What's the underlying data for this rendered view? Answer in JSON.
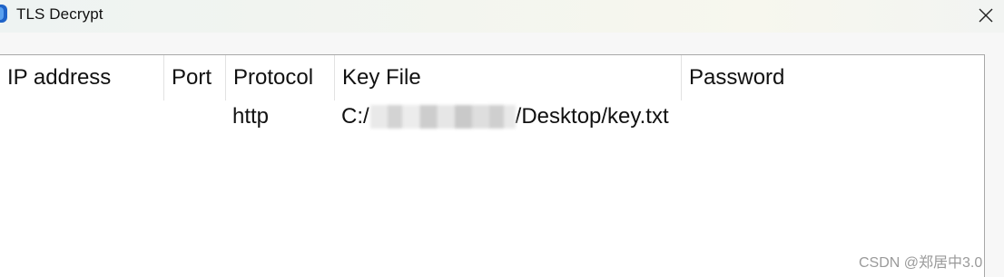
{
  "window": {
    "title": "TLS Decrypt",
    "close_icon": "close-icon"
  },
  "table": {
    "columns": [
      "IP address",
      "Port",
      "Protocol",
      "Key File",
      "Password"
    ],
    "rows": [
      {
        "ip_address": "",
        "port": "",
        "protocol": "http",
        "key_file_prefix": "C:/",
        "key_file_suffix": "/Desktop/key.txt",
        "password": ""
      }
    ]
  },
  "watermark": "CSDN @郑居中3.0"
}
